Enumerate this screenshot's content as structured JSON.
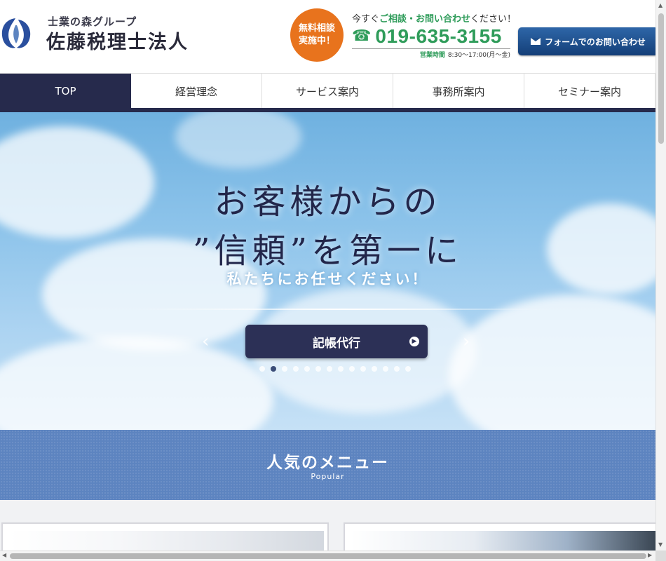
{
  "header": {
    "logo_sub": "士業の森グループ",
    "logo_main": "佐藤税理士法人",
    "badge_line1": "無料相談",
    "badge_line2": "実施中！",
    "contact_lead_pre": "今すぐ",
    "contact_lead_highlight": "ご相談・お問い合わせ",
    "contact_lead_post": "ください！",
    "phone": "019-635-3155",
    "hours_label": "営業時間",
    "hours_value": "8:30～17:00(月～金)",
    "form_button": "フォームでのお問い合わせ"
  },
  "nav": {
    "items": [
      {
        "label": "TOP"
      },
      {
        "label": "経営理念"
      },
      {
        "label": "サービス案内"
      },
      {
        "label": "事務所案内"
      },
      {
        "label": "セミナー案内"
      }
    ]
  },
  "hero": {
    "headline_line1": "お客様からの",
    "headline_line2": "”信頼”を第一に",
    "subheadline": "私たちにお任せください！",
    "slide_button": "記帳代行",
    "active_slide": 2,
    "slide_count": 14
  },
  "popular": {
    "title": "人気のメニュー",
    "subtitle": "Popular"
  },
  "colors": {
    "navy": "#262a4c",
    "green": "#2f9c5a",
    "orange": "#e8731d",
    "band_blue": "#5d84c0",
    "button_blue": "#1e4f8c"
  },
  "icons": {
    "phone": "phone-icon",
    "mail": "mail-icon",
    "prev": "chevron-left-icon",
    "next": "chevron-right-icon"
  }
}
